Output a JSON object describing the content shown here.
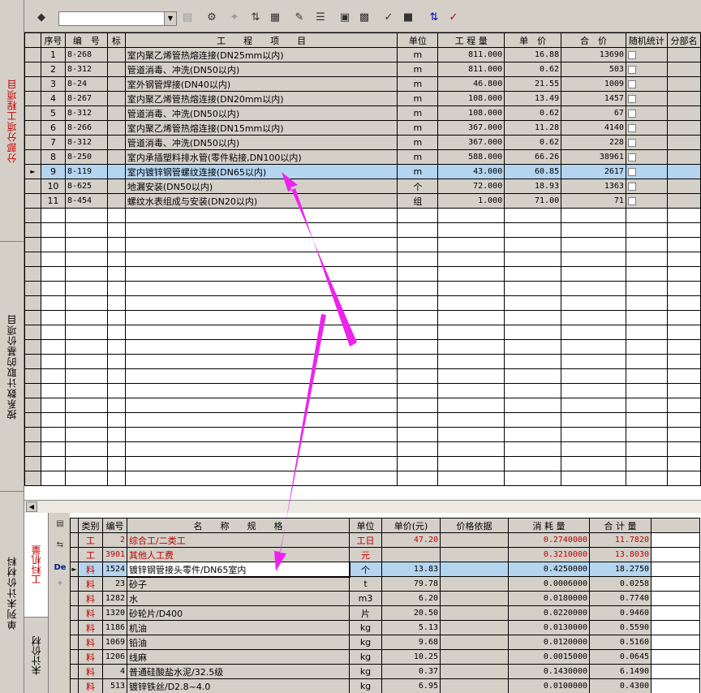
{
  "side_tabs": [
    {
      "label": "分部分项工程项目",
      "active": true
    },
    {
      "label": "按系数计取的基价项目",
      "active": false
    },
    {
      "label": "单列未计价材料",
      "active": false
    }
  ],
  "toolbar": {
    "combo_value": ""
  },
  "top_table": {
    "headers": [
      "序号",
      "编　号",
      "标",
      "工　　程　　项　　目",
      "单位",
      "工 程 量",
      "单　价",
      "合　价",
      "随机统计",
      "分部名"
    ],
    "rows": [
      {
        "seq": "1",
        "code": "8-268",
        "item": "室内聚乙烯管热熔连接(DN25mm以内)",
        "unit": "m",
        "qty": "811.000",
        "price": "16.88",
        "total": "13690"
      },
      {
        "seq": "2",
        "code": "8-312",
        "item": "管道消毒、冲洗(DN50以内)",
        "unit": "m",
        "qty": "811.000",
        "price": "0.62",
        "total": "503"
      },
      {
        "seq": "3",
        "code": "8-24",
        "item": "室外钢管焊接(DN40以内)",
        "unit": "m",
        "qty": "46.800",
        "price": "21.55",
        "total": "1009"
      },
      {
        "seq": "4",
        "code": "8-267",
        "item": "室内聚乙烯管热熔连接(DN20mm以内)",
        "unit": "m",
        "qty": "108.000",
        "price": "13.49",
        "total": "1457"
      },
      {
        "seq": "5",
        "code": "8-312",
        "item": "管道消毒、冲洗(DN50以内)",
        "unit": "m",
        "qty": "108.000",
        "price": "0.62",
        "total": "67"
      },
      {
        "seq": "6",
        "code": "8-266",
        "item": "室内聚乙烯管热熔连接(DN15mm以内)",
        "unit": "m",
        "qty": "367.000",
        "price": "11.28",
        "total": "4140"
      },
      {
        "seq": "7",
        "code": "8-312",
        "item": "管道消毒、冲洗(DN50以内)",
        "unit": "m",
        "qty": "367.000",
        "price": "0.62",
        "total": "228"
      },
      {
        "seq": "8",
        "code": "8-250",
        "item": "室内承插塑料排水管(零件粘接,DN100以内)",
        "unit": "m",
        "qty": "588.000",
        "price": "66.26",
        "total": "38961"
      },
      {
        "seq": "9",
        "code": "8-119",
        "item": "室内镀锌钢管螺纹连接(DN65以内)",
        "unit": "m",
        "qty": "43.000",
        "price": "60.85",
        "total": "2617",
        "selected": true
      },
      {
        "seq": "10",
        "code": "8-625",
        "item": "地漏安装(DN50以内)",
        "unit": "个",
        "qty": "72.000",
        "price": "18.93",
        "total": "1363"
      },
      {
        "seq": "11",
        "code": "8-454",
        "item": "螺纹水表组成与安装(DN20以内)",
        "unit": "组",
        "qty": "1.000",
        "price": "71.00",
        "total": "71"
      }
    ]
  },
  "bottom_tabs": [
    {
      "label": "工料机量",
      "active": true
    },
    {
      "label": "未计价材",
      "active": false
    }
  ],
  "bottom_table": {
    "headers": [
      "类别",
      "编号",
      "名　　称　　规　　格",
      "单位",
      "单价(元)",
      "价格依据",
      "消 耗 量",
      "合 计 量"
    ],
    "rows": [
      {
        "cat": "工",
        "code": "2",
        "name": "综合工/二类工",
        "unit": "工日",
        "price": "47.20",
        "basis": "",
        "consume": "0.2740000",
        "total": "11.7820",
        "red": true
      },
      {
        "cat": "工",
        "code": "3901",
        "name": "其他人工费",
        "unit": "元",
        "price": "",
        "basis": "",
        "consume": "0.3210000",
        "total": "13.8030",
        "red": true
      },
      {
        "cat": "料",
        "code": "1524",
        "name": "镀锌钢管接头零件/DN65室内",
        "unit": "个",
        "price": "13.83",
        "basis": "",
        "consume": "0.4250000",
        "total": "18.2750",
        "selected": true
      },
      {
        "cat": "料",
        "code": "23",
        "name": "砂子",
        "unit": "t",
        "price": "79.78",
        "basis": "",
        "consume": "0.0006000",
        "total": "0.0258"
      },
      {
        "cat": "料",
        "code": "1282",
        "name": "水",
        "unit": "m3",
        "price": "6.20",
        "basis": "",
        "consume": "0.0180000",
        "total": "0.7740"
      },
      {
        "cat": "料",
        "code": "1320",
        "name": "砂轮片/D400",
        "unit": "片",
        "price": "20.50",
        "basis": "",
        "consume": "0.0220000",
        "total": "0.9460"
      },
      {
        "cat": "料",
        "code": "1186",
        "name": "机油",
        "unit": "kg",
        "price": "5.13",
        "basis": "",
        "consume": "0.0130000",
        "total": "0.5590"
      },
      {
        "cat": "料",
        "code": "1069",
        "name": "铅油",
        "unit": "kg",
        "price": "9.68",
        "basis": "",
        "consume": "0.0120000",
        "total": "0.5160"
      },
      {
        "cat": "料",
        "code": "1206",
        "name": "线麻",
        "unit": "kg",
        "price": "10.25",
        "basis": "",
        "consume": "0.0015000",
        "total": "0.0645"
      },
      {
        "cat": "料",
        "code": "4",
        "name": "普通硅酸盐水泥/32.5级",
        "unit": "kg",
        "price": "0.37",
        "basis": "",
        "consume": "0.1430000",
        "total": "6.1490"
      },
      {
        "cat": "料",
        "code": "513",
        "name": "镀锌铁丝/D2.8~4.0",
        "unit": "kg",
        "price": "6.95",
        "basis": "",
        "consume": "0.0100000",
        "total": "0.4300"
      }
    ]
  },
  "colors": {
    "accent_red": "#c00000",
    "selection": "#b4d4f0",
    "arrow": "#ee22ee",
    "grey": "#d4d0c8"
  }
}
